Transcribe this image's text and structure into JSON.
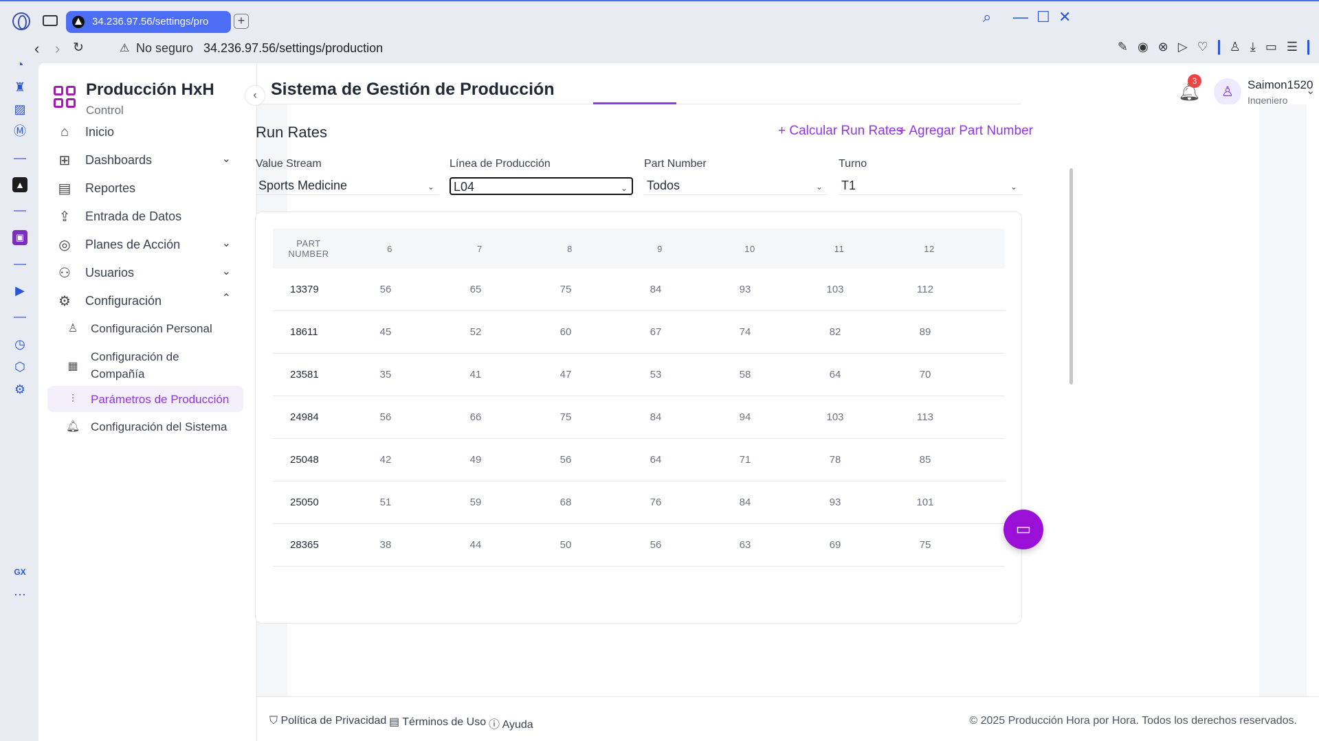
{
  "browser": {
    "tab_title": "34.236.97.56/settings/pro",
    "security": "No seguro",
    "url": "34.236.97.56/settings/production"
  },
  "brand": {
    "title": "Producción HxH",
    "subtitle": "Control"
  },
  "sidebar": {
    "items": [
      {
        "label": "Inicio",
        "icon": "home-icon"
      },
      {
        "label": "Dashboards",
        "icon": "grid-icon"
      },
      {
        "label": "Reportes",
        "icon": "report-icon"
      },
      {
        "label": "Entrada de Datos",
        "icon": "upload-icon"
      },
      {
        "label": "Planes de Acción",
        "icon": "target-icon"
      },
      {
        "label": "Usuarios",
        "icon": "users-icon"
      },
      {
        "label": "Configuración",
        "icon": "gear-icon"
      }
    ],
    "subitems": [
      {
        "label": "Configuración Personal",
        "icon": "user-icon"
      },
      {
        "label": "Configuración de Compañía",
        "icon": "building-icon"
      },
      {
        "label": "Parámetros de Producción",
        "icon": "sliders-icon"
      },
      {
        "label": "Configuración del Sistema",
        "icon": "bell-icon"
      }
    ]
  },
  "header": {
    "title": "Sistema de Gestión de Producción",
    "notifications": "3",
    "user_name": "Saimon1520",
    "user_role": "Ingeniero"
  },
  "main": {
    "section_title": "Run Rates",
    "actions": {
      "calc": "Calcular Run Rates",
      "add": "Agregar Part Number"
    },
    "filters": [
      {
        "label": "Value Stream",
        "value": "Sports Medicine"
      },
      {
        "label": "Línea de Producción",
        "value": "L04"
      },
      {
        "label": "Part Number",
        "value": "Todos"
      },
      {
        "label": "Turno",
        "value": "T1"
      }
    ],
    "table": {
      "headers": [
        "PART NUMBER",
        "6",
        "7",
        "8",
        "9",
        "10",
        "11",
        "12"
      ],
      "rows": [
        [
          "13379",
          "56",
          "65",
          "75",
          "84",
          "93",
          "103",
          "112"
        ],
        [
          "18611",
          "45",
          "52",
          "60",
          "67",
          "74",
          "82",
          "89"
        ],
        [
          "23581",
          "35",
          "41",
          "47",
          "53",
          "58",
          "64",
          "70"
        ],
        [
          "24984",
          "56",
          "66",
          "75",
          "84",
          "94",
          "103",
          "113"
        ],
        [
          "25048",
          "42",
          "49",
          "56",
          "64",
          "71",
          "78",
          "85"
        ],
        [
          "25050",
          "51",
          "59",
          "68",
          "76",
          "84",
          "93",
          "101"
        ],
        [
          "28365",
          "38",
          "44",
          "50",
          "56",
          "63",
          "69",
          "75"
        ]
      ]
    }
  },
  "footer": {
    "privacy": "Política de Privacidad",
    "terms": "Términos de Uso",
    "help": "Ayuda",
    "copyright": "© 2025 Producción Hora por Hora. Todos los derechos reservados."
  },
  "colors": {
    "accent": "#9333ea",
    "tab": "#4c6ef5",
    "badge": "#ef4444",
    "fab": "#9b10d6"
  }
}
